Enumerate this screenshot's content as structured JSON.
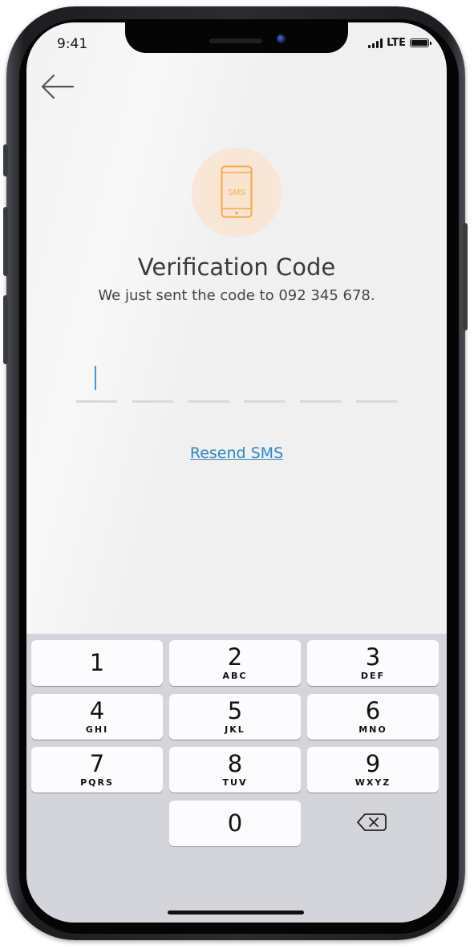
{
  "status_bar": {
    "time": "9:41",
    "network": "LTE"
  },
  "header": {
    "back_icon": "arrow-left-icon"
  },
  "badge": {
    "icon": "sms-phone-icon",
    "icon_text": "SMS",
    "accent": "#f4a94f",
    "background": "#f8e3d0"
  },
  "verification": {
    "title": "Verification Code",
    "subtitle": "We just sent the code to 092 345 678.",
    "code_length": 6,
    "entered_digits": "",
    "cursor_color": "#3a9ad9"
  },
  "resend": {
    "label": "Resend SMS",
    "color": "#2f86c5"
  },
  "keypad": {
    "keys": [
      {
        "digit": "1",
        "letters": ""
      },
      {
        "digit": "2",
        "letters": "ABC"
      },
      {
        "digit": "3",
        "letters": "DEF"
      },
      {
        "digit": "4",
        "letters": "GHI"
      },
      {
        "digit": "5",
        "letters": "JKL"
      },
      {
        "digit": "6",
        "letters": "MNO"
      },
      {
        "digit": "7",
        "letters": "PQRS"
      },
      {
        "digit": "8",
        "letters": "TUV"
      },
      {
        "digit": "9",
        "letters": "WXYZ"
      },
      {
        "digit": "0",
        "letters": ""
      }
    ],
    "delete_icon": "backspace-icon"
  }
}
